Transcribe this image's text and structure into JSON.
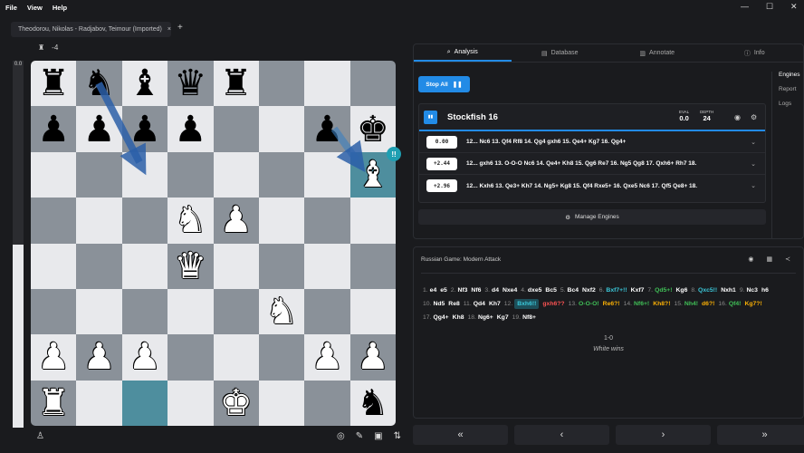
{
  "menu": [
    "File",
    "View",
    "Help"
  ],
  "window": {
    "minimize": "—",
    "maximize": "☐",
    "close": "✕"
  },
  "tab": {
    "title": "Theodorou, Nikolas - Radjabov, Teimour (Imported)",
    "close": "×",
    "add": "+"
  },
  "material": {
    "icon": "rook",
    "value": "-4"
  },
  "eval_bar": {
    "label": "0.0",
    "white_fraction": 0.5
  },
  "board": {
    "ranks": [
      [
        "bR",
        "bN",
        "bB",
        "bQ",
        "bR",
        "",
        "",
        ""
      ],
      [
        "bP",
        "bP",
        "bP",
        "bP",
        "",
        "",
        "bP",
        "bK"
      ],
      [
        "",
        "",
        "",
        "",
        "",
        "",
        "",
        "wB"
      ],
      [
        "",
        "",
        "",
        "wN",
        "wP",
        "",
        "",
        ""
      ],
      [
        "",
        "",
        "",
        "wQ",
        "",
        "",
        "",
        ""
      ],
      [
        "",
        "",
        "",
        "",
        "",
        "wN",
        "",
        ""
      ],
      [
        "wP",
        "wP",
        "wP",
        "",
        "",
        "",
        "wP",
        "wP"
      ],
      [
        "wR",
        "",
        "",
        "",
        "wK",
        "",
        "",
        "bN"
      ]
    ],
    "highlighted": [
      "h6",
      "c1"
    ],
    "annotation_badge": "!!",
    "colors": {
      "light": "#e8e9ec",
      "dark": "#8a9199",
      "highlight": "#4e8e9e"
    }
  },
  "analysis": {
    "tabs": [
      {
        "label": "Analysis",
        "icon": "search-icon"
      },
      {
        "label": "Database",
        "icon": "database-icon"
      },
      {
        "label": "Annotate",
        "icon": "notebook-icon"
      },
      {
        "label": "Info",
        "icon": "info-icon"
      }
    ],
    "stop_all": "Stop All",
    "side": [
      "Engines",
      "Report",
      "Logs"
    ],
    "engine": {
      "name": "Stockfish 16",
      "eval_label": "EVAL",
      "eval": "0.0",
      "depth_label": "DEPTH",
      "depth": "24"
    },
    "lines": [
      {
        "score": "0.00",
        "pv": "12... Nc6 13. Qf4 Rf8 14. Qg4 gxh6 15. Qe4+ Kg7 16. Qg4+"
      },
      {
        "score": "+2.44",
        "pv": "12... gxh6 13. O-O-O Nc6 14. Qe4+ Kh8 15. Qg6 Re7 16. Ng5 Qg8 17. Qxh6+ Rh7 18."
      },
      {
        "score": "+2.96",
        "pv": "12... Kxh6 13. Qe3+ Kh7 14. Ng5+ Kg8 15. Qf4 Rxe5+ 16. Qxe5 Nc6 17. Qf5 Qe8+ 18."
      }
    ],
    "manage": "Manage Engines"
  },
  "notation": {
    "opening": "Russian Game: Modern Attack",
    "moves": [
      {
        "n": "1."
      },
      {
        "m": "e4"
      },
      {
        "m": "e5"
      },
      {
        "n": "2."
      },
      {
        "m": "Nf3"
      },
      {
        "m": "Nf6"
      },
      {
        "n": "3."
      },
      {
        "m": "d4"
      },
      {
        "m": "Nxe4"
      },
      {
        "n": "4."
      },
      {
        "m": "dxe5"
      },
      {
        "m": "Bc5"
      },
      {
        "n": "5."
      },
      {
        "m": "Bc4"
      },
      {
        "m": "Nxf2"
      },
      {
        "n": "6."
      },
      {
        "m": "Bxf7+!!",
        "c": "#3bc9db"
      },
      {
        "m": "Kxf7"
      },
      {
        "n": "7."
      },
      {
        "m": "Qd5+!",
        "c": "#40c057"
      },
      {
        "m": "Kg6"
      },
      {
        "n": "8."
      },
      {
        "m": "Qxc5!!",
        "c": "#3bc9db"
      },
      {
        "m": "Nxh1"
      },
      {
        "n": "9."
      },
      {
        "m": "Nc3"
      },
      {
        "m": "h6"
      },
      {
        "n": "10."
      },
      {
        "m": "Nd5"
      },
      {
        "m": "Re8"
      },
      {
        "n": "11."
      },
      {
        "m": "Qd4"
      },
      {
        "m": "Kh7"
      },
      {
        "n": "12."
      },
      {
        "m": "Bxh6!!",
        "c": "#3bc9db",
        "sel": true
      },
      {
        "m": "gxh6??",
        "c": "#fa5252"
      },
      {
        "n": "13."
      },
      {
        "m": "O-O-O!",
        "c": "#40c057"
      },
      {
        "m": "Re6?!",
        "c": "#fab005"
      },
      {
        "n": "14."
      },
      {
        "m": "Nf6+!",
        "c": "#40c057"
      },
      {
        "m": "Kh8?!",
        "c": "#fab005"
      },
      {
        "n": "15."
      },
      {
        "m": "Nh4!",
        "c": "#40c057"
      },
      {
        "m": "d6?!",
        "c": "#fab005"
      },
      {
        "n": "16."
      },
      {
        "m": "Qf4!",
        "c": "#40c057"
      },
      {
        "m": "Kg7?!",
        "c": "#fab005"
      },
      {
        "n": "17."
      },
      {
        "m": "Qg4+"
      },
      {
        "m": "Kh8"
      },
      {
        "n": "18."
      },
      {
        "m": "Ng6+"
      },
      {
        "m": "Kg7"
      },
      {
        "n": "19."
      },
      {
        "m": "Nf8+"
      }
    ],
    "result": "1-0",
    "result_text": "White wins"
  },
  "nav": [
    "«",
    "‹",
    "›",
    "»"
  ]
}
